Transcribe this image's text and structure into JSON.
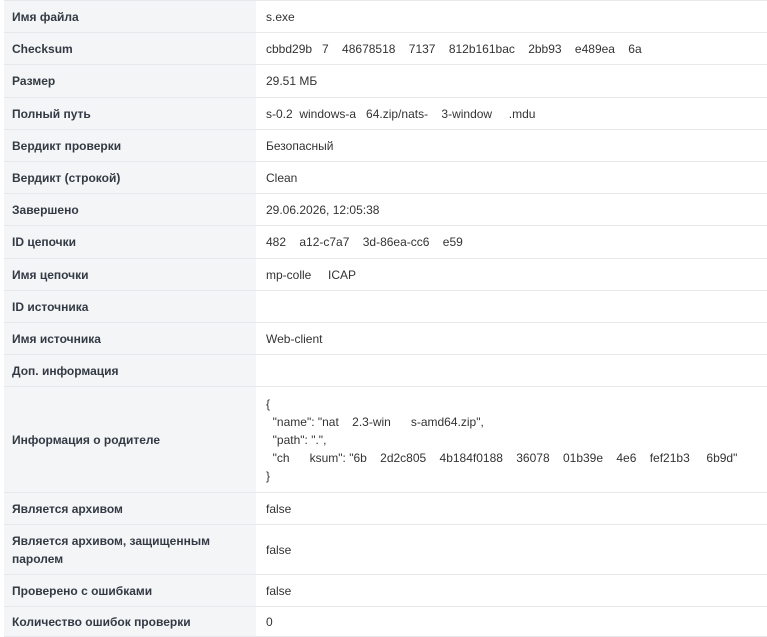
{
  "rows": [
    {
      "key": "Имя файла",
      "value": "s.exe",
      "h": 32
    },
    {
      "key": "Checksum",
      "value": "cbbd29b   7    48678518    7137    812b161bac    2bb93    e489ea    6a",
      "h": 32
    },
    {
      "key": "Размер",
      "value": "29.51 МБ",
      "h": 33
    },
    {
      "key": "Полный путь",
      "value": "s-0.2  windows-a   64.zip/nats-    3-window     .mdu",
      "h": 32
    },
    {
      "key": "Вердикт проверки",
      "value": "Безопасный",
      "h": 32
    },
    {
      "key": "Вердикт (строкой)",
      "value": "Clean",
      "h": 32
    },
    {
      "key": "Завершено",
      "value": "29.06.2026, 12:05:38",
      "h": 32
    },
    {
      "key": "ID цепочки",
      "value": "482    a12-c7a7    3d-86ea-cc6    e59",
      "h": 33
    },
    {
      "key": "Имя цепочки",
      "value": "mp-colle     ICAP",
      "h": 32
    },
    {
      "key": "ID источника",
      "value": "",
      "h": 32
    },
    {
      "key": "Имя источника",
      "value": "Web-client",
      "h": 32
    },
    {
      "key": "Доп. информация",
      "value": "",
      "h": 32
    },
    {
      "key": "Информация о родителе",
      "value": "{\n  \"name\": \"nat    2.3-win      s-amd64.zip\",\n  \"path\": \".\",\n  \"ch      ksum\": \"6b    2d2c805    4b184f0188    36078    01b39e    4e6    fef21b3     6b9d\"\n}",
      "h": 106,
      "json": true
    },
    {
      "key": "Является архивом",
      "value": "false",
      "h": 32
    },
    {
      "key": "Является архивом, защищенным паролем",
      "value": "false",
      "h": 50
    },
    {
      "key": "Проверено с ошибками",
      "value": "false",
      "h": 32
    },
    {
      "key": "Количество ошибок проверки",
      "value": "0",
      "h": 30
    }
  ]
}
